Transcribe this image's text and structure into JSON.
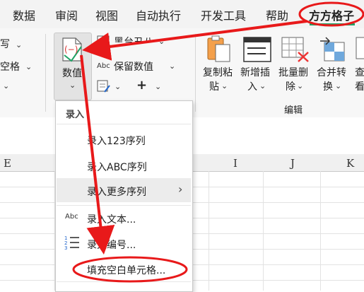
{
  "menubar": {
    "tabs": [
      {
        "label": "数据"
      },
      {
        "label": "审阅"
      },
      {
        "label": "视图"
      },
      {
        "label": "自动执行"
      },
      {
        "label": "开发工具"
      },
      {
        "label": "帮助"
      },
      {
        "label": "方方格子"
      }
    ]
  },
  "ribbon": {
    "left_partial": {
      "item1": "写",
      "item2": "空格"
    },
    "number_button": {
      "label": "数值",
      "icon_text": "(−)"
    },
    "merge_label_partial": "黑台丑八",
    "keep_value": {
      "abc": "Abc",
      "label": "保留数值"
    },
    "plus": "+",
    "buttons": [
      {
        "line1": "复制粘",
        "line2": "贴"
      },
      {
        "line1": "新增插",
        "line2": "入"
      },
      {
        "line1": "批量删",
        "line2": "除"
      },
      {
        "line1": "合并转",
        "line2": "换"
      },
      {
        "line1": "查",
        "line2": "看"
      }
    ],
    "group_label": "编辑"
  },
  "sheet": {
    "columns": [
      "E",
      "I",
      "J",
      "K"
    ]
  },
  "dropdown": {
    "header": "录入",
    "items": [
      {
        "label": "录入123序列"
      },
      {
        "label": "录入ABC序列"
      },
      {
        "label": "录入更多序列"
      },
      {
        "label": "录入文本..."
      },
      {
        "label": "录入编号..."
      },
      {
        "label": "填充空白单元格..."
      }
    ],
    "abc_icon": "Abc"
  },
  "colors": {
    "annotation": "#e8191a",
    "accent_green": "#21a366"
  }
}
